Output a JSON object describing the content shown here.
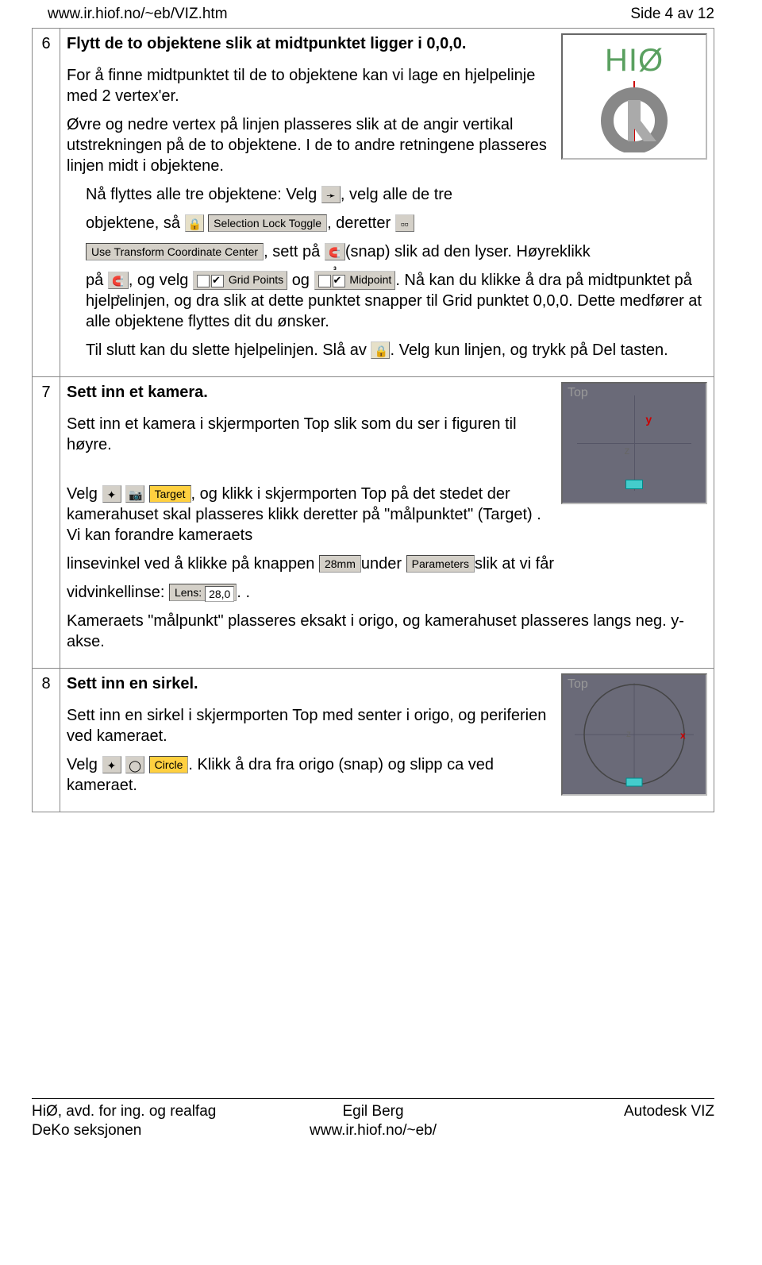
{
  "header": {
    "url": "www.ir.hiof.no/~eb/VIZ.htm",
    "pageinfo": "Side 4 av 12"
  },
  "steps": [
    {
      "num": "6",
      "title": "Flytt de to objektene slik at midtpunktet ligger i 0,0,0.",
      "p1": "For å finne midtpunktet til de to objektene kan vi lage en hjelpelinje med 2 vertex'er.",
      "p2": "Øvre og nedre vertex på linjen plasseres slik at de angir vertikal utstrekningen på de to objektene. I de to andre retningene plasseres linjen midt i objektene.",
      "p3_a": "Nå flyttes alle tre objektene: Velg",
      "p3_b": ", velg alle de tre",
      "p3_c": "objektene, så",
      "lockToggle": "Selection Lock Toggle",
      "p3_d": ", deretter",
      "useTransform": "Use Transform Coordinate Center",
      "p3_e": ", sett på",
      "p3_f": "(snap) slik ad den lyser. Høyreklikk",
      "p3_g": "på",
      "p3_h": ", og velg",
      "gridPoints": "Grid Points",
      "p3_i": "og",
      "midpoint": "Midpoint",
      "p3_j": ". Nå kan du klikke å dra på midtpunktet på hjelpelinjen, og dra slik at dette punktet snapper til Grid punktet 0,0,0. Dette medfører at alle objektene flyttes dit du ønsker.",
      "p4_a": "Til slutt kan du slette hjelpelinjen. Slå av",
      "p4_b": ". Velg kun linjen, og trykk på Del tasten.",
      "logoText": "HIØ"
    },
    {
      "num": "7",
      "title": "Sett inn et kamera.",
      "p1": "Sett inn et kamera i skjermporten Top slik som du ser i figuren til høyre.",
      "p2_a": "Velg",
      "targetLabel": "Target",
      "p2_b": ", og klikk i skjermporten Top på det stedet der kamerahuset skal plasseres klikk deretter på \"målpunktet\" (Target) . Vi kan forandre kameraets",
      "p3_a": "linsevinkel ved å klikke på knappen",
      "mmVal": "28mm",
      "p3_b": "under",
      "parameters": "Parameters",
      "p3_c": "slik at vi får",
      "p4_a": "vidvinkellinse:",
      "lensLabel": "Lens:",
      "lensVal": "28,0",
      "p4_b": ". .",
      "p5": "Kameraets \"målpunkt\" plasseres eksakt i origo, og kamerahuset plasseres langs neg. y-akse.",
      "topLabel": "Top",
      "axisY": "y",
      "axisZ": "z"
    },
    {
      "num": "8",
      "title": "Sett inn en sirkel.",
      "p1": "Sett inn en sirkel  i skjermporten Top med senter i origo,  og periferien ved kameraet.",
      "p2_a": "Velg",
      "circleLabel": "Circle",
      "p2_b": ". Klikk å dra fra origo (snap) og slipp ca ved kameraet.",
      "topLabel": "Top"
    }
  ],
  "footer": {
    "left1": "HiØ, avd. for ing. og realfag",
    "left2": "DeKo seksjonen",
    "mid1": "Egil Berg",
    "mid2": "www.ir.hiof.no/~eb/",
    "right": "Autodesk VIZ"
  }
}
